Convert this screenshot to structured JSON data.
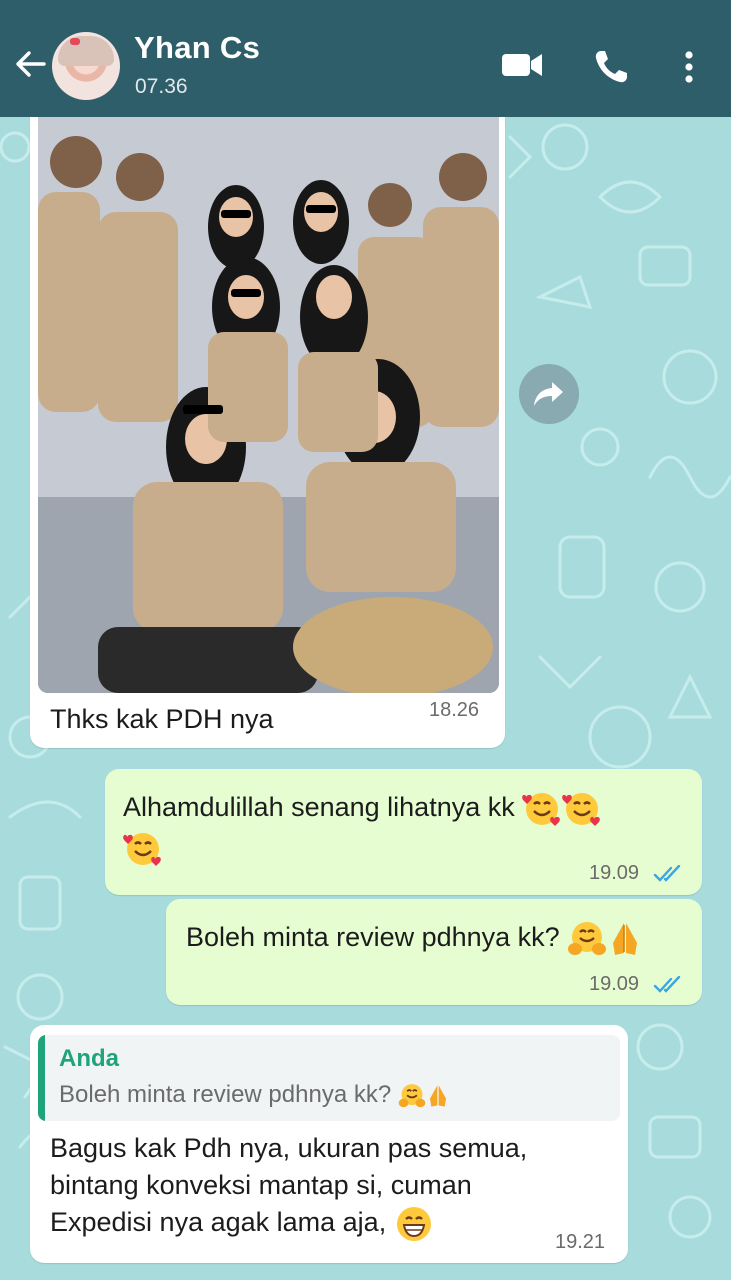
{
  "header": {
    "contact_name": "Yhan Cs",
    "status": "07.36",
    "bg_color": "#2f5e6b",
    "icons": [
      "back-arrow-icon",
      "video-call-icon",
      "phone-icon",
      "more-options-icon"
    ]
  },
  "messages": [
    {
      "direction": "incoming",
      "type": "image",
      "caption": "Thks kak PDH nya",
      "time": "18.26"
    },
    {
      "direction": "outgoing",
      "text_line1": "Alhamdulillah senang lihatnya kk",
      "emojis": [
        "smiling-face-with-hearts",
        "smiling-face-with-hearts",
        "smiling-face-with-hearts"
      ],
      "time": "19.09",
      "status": "read"
    },
    {
      "direction": "outgoing",
      "text": "Boleh minta review pdhnya kk?",
      "emojis": [
        "hugging-face",
        "folded-hands"
      ],
      "time": "19.09",
      "status": "read"
    },
    {
      "direction": "incoming",
      "quote": {
        "author": "Anda",
        "text": "Boleh minta review pdhnya kk?"
      },
      "text_line1": "Bagus kak Pdh nya, ukuran pas semua,",
      "text_line2": "bintang konveksi mantap si,  cuman",
      "text_line3": "Expedisi nya agak lama aja,",
      "emojis": [
        "grinning-face"
      ],
      "time": "19.21"
    }
  ],
  "colors": {
    "outgoing_bubble": "#e6fdd2",
    "incoming_bubble": "#ffffff",
    "read_ticks": "#3aa7e0",
    "quote_accent": "#1fa37a",
    "wallpaper": "#a8dcdc"
  }
}
